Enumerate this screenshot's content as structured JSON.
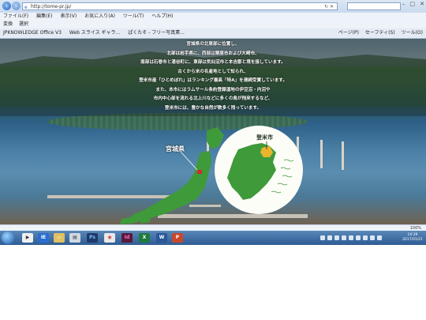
{
  "browser": {
    "address": "http://tome-pr.jp/",
    "menu": [
      "ファイル(F)",
      "編集(E)",
      "表示(V)",
      "お気に入り(A)",
      "ツール(T)",
      "ヘルプ(H)"
    ],
    "favorites_bar": [
      "変換",
      "選択"
    ],
    "bookmarks": [
      "JPKNOWLEDGE Office V3",
      "Web スライス ギャラ...",
      "ぱくたそ - フリー写真素..."
    ],
    "command_bar": [
      "ページ(P)",
      "セーフティ(S)",
      "ツール(O)"
    ],
    "zoom": "100%"
  },
  "page": {
    "intro_lines": [
      "宮城県の北東部に位置し、",
      "北部は岩手県に、西部は栗原市および大崎市、",
      "南部は石巻市と涌谷町に、東部は気仙沼市と本吉郡と境を接しています。",
      "古くから米の名産地として知られ、",
      "登米市産「ひとめぼれ」はランキング最高「特A」を連続受賞しています。",
      "また、本市にはラムサール条約登録湿地の伊豆沼・内沼や",
      "市内中心部を流れる北上川などに多くの鳥が飛来するなど、",
      "登米市には、豊かな自然が数多く残っています。"
    ],
    "pref_label": "宮城県",
    "city_label": "登米市"
  },
  "taskbar": {
    "apps": [
      "IE",
      "Ps",
      "Id",
      "X",
      "W",
      "P"
    ],
    "time": "14:39",
    "date": "2017/01/21"
  },
  "colors": {
    "map_green": "#3f9a3a",
    "city_highlight": "#e8b52c",
    "pref_marker": "#d42a2a"
  }
}
